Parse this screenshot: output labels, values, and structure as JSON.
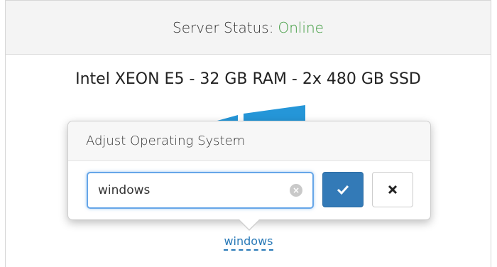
{
  "panel": {
    "header": {
      "label": "Server Status:",
      "value": "Online"
    },
    "spec": "Intel XEON E5 - 32 GB RAM - 2x 480 GB SSD"
  },
  "popover": {
    "title": "Adjust Operating System",
    "input_value": "windows",
    "clear_icon": "clear-icon",
    "submit_icon": "check-icon",
    "cancel_icon": "close-icon"
  },
  "editable": {
    "value": "windows"
  },
  "colors": {
    "status_online": "#3c9a3c",
    "primary_button": "#337ab7",
    "link": "#2a7ab8",
    "os_logo": "#2596d8"
  }
}
